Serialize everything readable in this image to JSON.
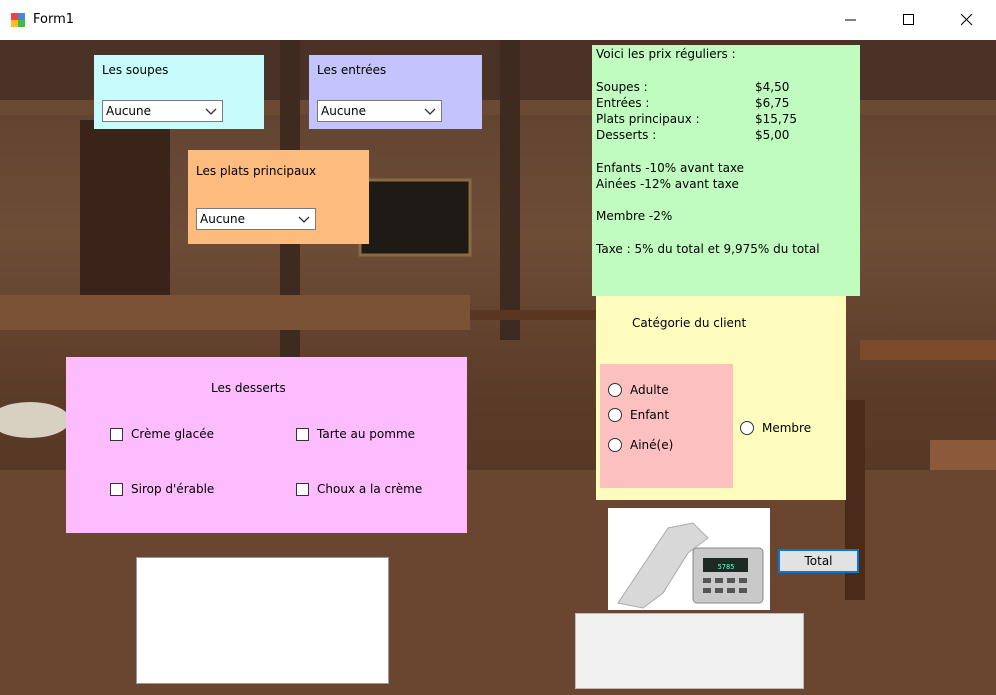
{
  "window": {
    "title": "Form1"
  },
  "soupes": {
    "label": "Les soupes",
    "selected": "Aucune"
  },
  "entrees": {
    "label": "Les entrées",
    "selected": "Aucune"
  },
  "plats": {
    "label": "Les plats principaux",
    "selected": "Aucune"
  },
  "desserts": {
    "label": "Les desserts",
    "items": [
      "Crème glacée",
      "Tarte au pomme",
      "Sirop d'érable",
      "Choux a la crème"
    ]
  },
  "prices": {
    "header": "Voici les prix réguliers :",
    "rows": [
      {
        "name": "Soupes :",
        "amount": "$4,50"
      },
      {
        "name": "Entrées :",
        "amount": "$6,75"
      },
      {
        "name": "Plats principaux :",
        "amount": "$15,75"
      },
      {
        "name": "Desserts :",
        "amount": "$5,00"
      }
    ],
    "enfants": "Enfants  -10% avant taxe",
    "ainees": "Ainées   -12% avant taxe",
    "membre": "Membre  -2%",
    "taxe": "Taxe : 5% du total et 9,975% du total"
  },
  "category": {
    "label": "Catégorie du client",
    "options": [
      "Adulte",
      "Enfant",
      "Ainé(e)"
    ],
    "membre": "Membre"
  },
  "total_button": "Total",
  "colors": {
    "soupes_bg": "#c8fcfc",
    "entrees_bg": "#c3c3fd",
    "plats_bg": "#fdbc7e",
    "desserts_bg": "#fdbcfd",
    "prices_bg": "#c0fcc0",
    "category_bg": "#fefcbd",
    "age_group_bg": "#fdc0c0"
  }
}
